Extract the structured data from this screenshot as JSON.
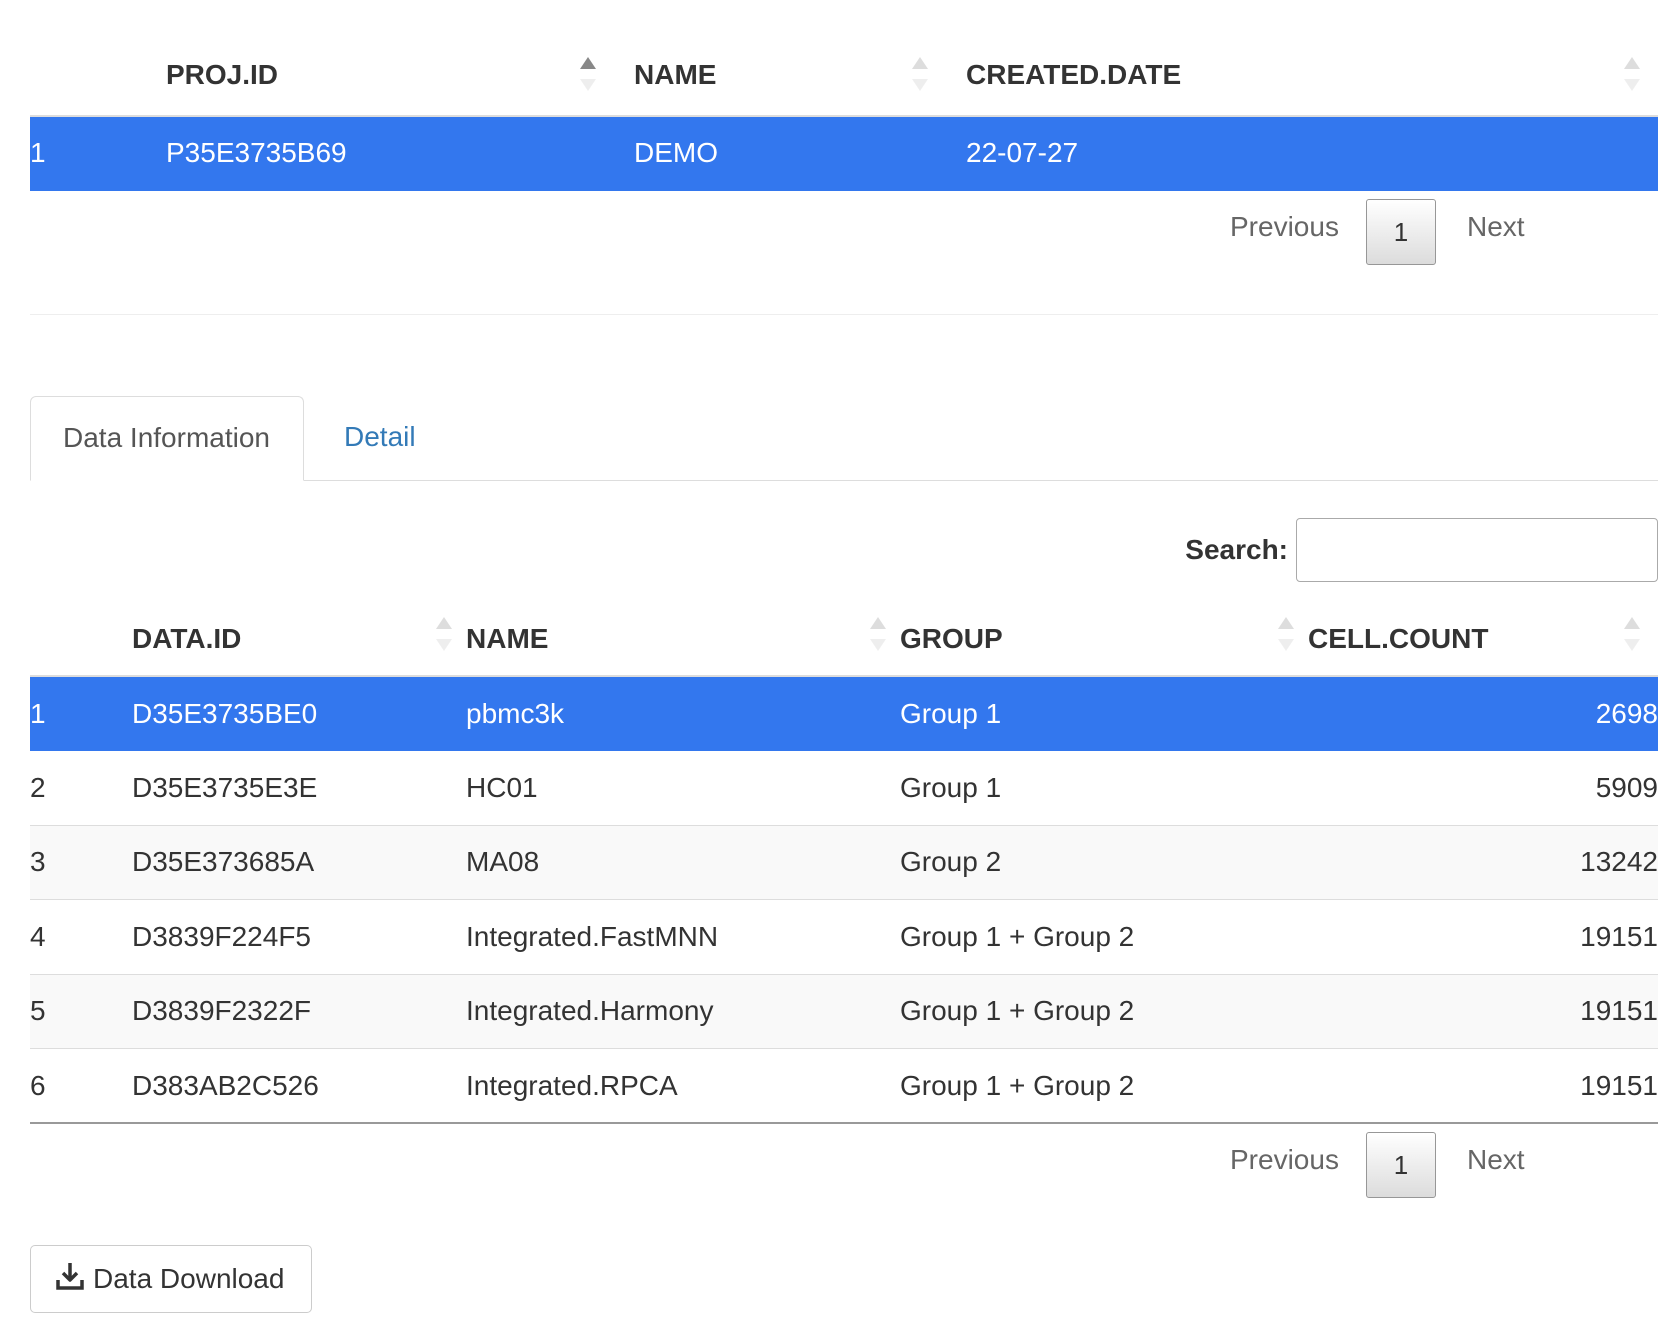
{
  "project_table": {
    "columns": [
      "",
      "PROJ.ID",
      "NAME",
      "CREATED.DATE"
    ],
    "rows": [
      {
        "index": "1",
        "proj_id": "P35E3735B69",
        "name": "DEMO",
        "created_date": "22-07-27"
      }
    ],
    "pager": {
      "previous": "Previous",
      "page": "1",
      "next": "Next"
    }
  },
  "tabs": [
    {
      "label": "Data Information",
      "active": true
    },
    {
      "label": "Detail",
      "active": false
    }
  ],
  "search": {
    "label": "Search:",
    "value": ""
  },
  "data_table": {
    "columns": [
      "",
      "DATA.ID",
      "NAME",
      "GROUP",
      "CELL.COUNT"
    ],
    "rows": [
      {
        "index": "1",
        "data_id": "D35E3735BE0",
        "name": "pbmc3k",
        "group": "Group 1",
        "cell_count": "2698"
      },
      {
        "index": "2",
        "data_id": "D35E3735E3E",
        "name": "HC01",
        "group": "Group 1",
        "cell_count": "5909"
      },
      {
        "index": "3",
        "data_id": "D35E373685A",
        "name": "MA08",
        "group": "Group 2",
        "cell_count": "13242"
      },
      {
        "index": "4",
        "data_id": "D3839F224F5",
        "name": "Integrated.FastMNN",
        "group": "Group 1 + Group 2",
        "cell_count": "19151"
      },
      {
        "index": "5",
        "data_id": "D3839F2322F",
        "name": "Integrated.Harmony",
        "group": "Group 1 + Group 2",
        "cell_count": "19151"
      },
      {
        "index": "6",
        "data_id": "D383AB2C526",
        "name": "Integrated.RPCA",
        "group": "Group 1 + Group 2",
        "cell_count": "19151"
      }
    ],
    "pager": {
      "previous": "Previous",
      "page": "1",
      "next": "Next"
    }
  },
  "download_button": {
    "label": "Data Download",
    "icon": "download-icon"
  },
  "colors": {
    "selected_row": "#3377ee",
    "link": "#337ab7"
  }
}
